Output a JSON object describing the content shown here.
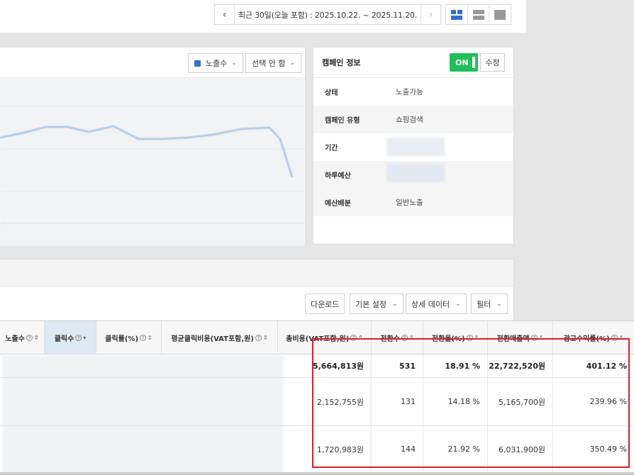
{
  "header": {
    "prev_label": "‹",
    "date_range": "최근 30일(오늘 포함) : 2025.10.22. ~ 2025.11.20.",
    "next_label": "›"
  },
  "chart": {
    "metric_label": "노출수",
    "compare_label": "선택 안 함"
  },
  "campaign": {
    "title": "캠페인 정보",
    "toggle_label": "ON",
    "edit_label": "수정",
    "rows": [
      {
        "key": "상태",
        "value": "노출가능"
      },
      {
        "key": "캠페인 유형",
        "value": "쇼핑검색"
      },
      {
        "key": "기간",
        "value": ""
      },
      {
        "key": "하루예산",
        "value": ""
      },
      {
        "key": "예산배분",
        "value": "일반노출"
      }
    ]
  },
  "toolbar": {
    "download": "다운로드",
    "basic_settings": "기본 설정",
    "detail_data": "상세 데이터",
    "filter": "필터"
  },
  "table": {
    "headers": [
      "노출수",
      "클릭수",
      "클릭률(%)",
      "평균클릭비용(VAT포함,원)",
      "총비용(VAT포함,원)",
      "전환수",
      "전환율(%)",
      "전환매출액",
      "광고수익률(%)"
    ],
    "rows": [
      {
        "cost": "5,664,813원",
        "conversions": "531",
        "conv_rate": "18.91 %",
        "revenue": "22,722,520원",
        "roas": "401.12 %"
      },
      {
        "cost": "2,152,755원",
        "conversions": "131",
        "conv_rate": "14.18 %",
        "revenue": "5,165,700원",
        "roas": "239.96 %"
      },
      {
        "cost": "1,720,983원",
        "conversions": "144",
        "conv_rate": "21.92 %",
        "revenue": "6,031,900원",
        "roas": "350.49 %"
      }
    ]
  },
  "colors": {
    "accent_blue": "#2e6fd6",
    "on_green": "#1fbf5a",
    "highlight_red": "#d6202a"
  }
}
